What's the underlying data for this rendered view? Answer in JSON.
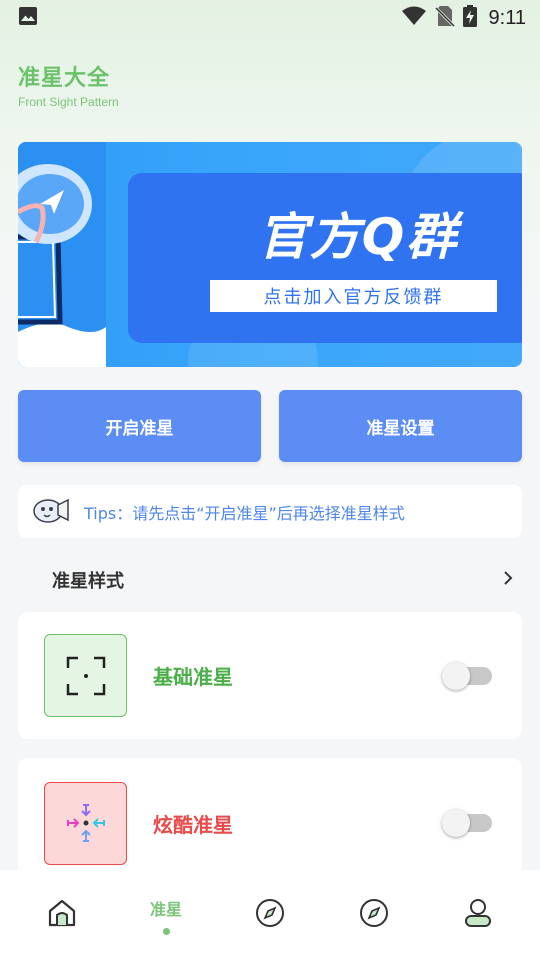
{
  "status_bar": {
    "time": "9:11",
    "icons": [
      "image-icon",
      "wifi-icon",
      "no-sim-icon",
      "battery-charging-icon"
    ]
  },
  "header": {
    "title": "准星大全",
    "subtitle": "Front Sight Pattern"
  },
  "banner": {
    "headline": "官方Q群",
    "join_text": "点击加入官方反馈群"
  },
  "actions": {
    "start_label": "开启准星",
    "settings_label": "准星设置"
  },
  "tips": {
    "icon": "megaphone-icon",
    "text": "Tips：请先点击“开启准星”后再选择准星样式"
  },
  "styles_section": {
    "title": "准星样式",
    "items": [
      {
        "label": "基础准星",
        "enabled": false,
        "icon": "basic-crosshair-icon"
      },
      {
        "label": "炫酷准星",
        "enabled": false,
        "icon": "cool-crosshair-icon"
      }
    ]
  },
  "bottom_nav": {
    "items": [
      {
        "name": "home",
        "label": "",
        "icon": "home-icon",
        "active": false
      },
      {
        "name": "crosshair",
        "label": "准星",
        "icon": "",
        "active": true
      },
      {
        "name": "compass-1",
        "label": "",
        "icon": "compass-icon",
        "active": false
      },
      {
        "name": "compass-2",
        "label": "",
        "icon": "compass-icon",
        "active": false
      },
      {
        "name": "profile",
        "label": "",
        "icon": "user-icon",
        "active": false
      }
    ]
  },
  "colors": {
    "accent_green": "#6cc26a",
    "button_blue": "#5b8df5",
    "tips_blue": "#4e86e8",
    "cool_red": "#e84b4b"
  }
}
